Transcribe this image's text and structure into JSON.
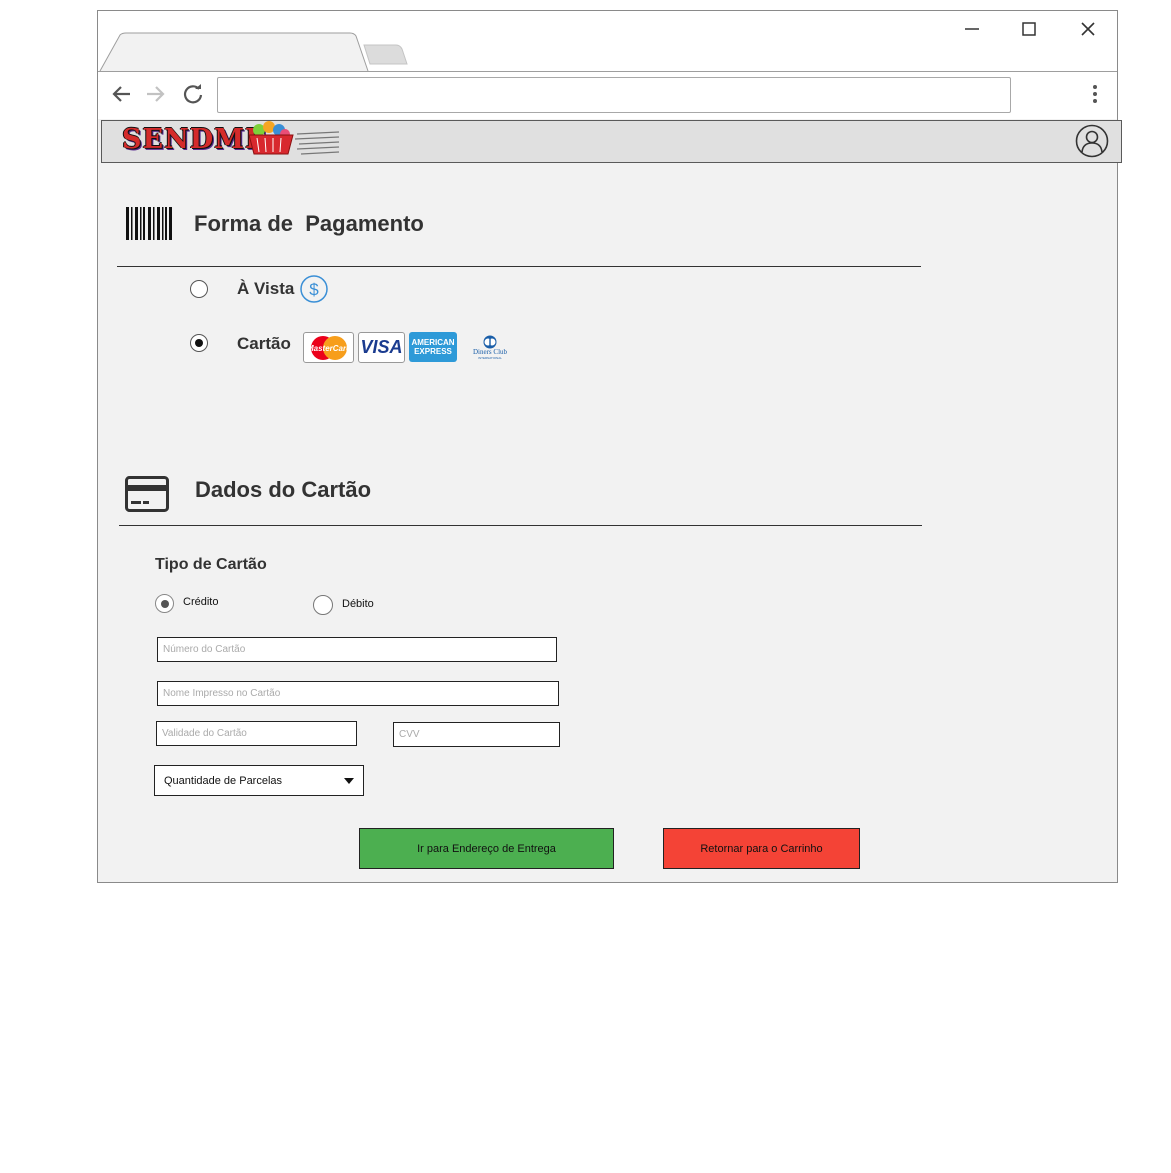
{
  "browser": {
    "address_value": "",
    "window_controls": [
      "minimize-icon",
      "maximize-icon",
      "close-icon"
    ]
  },
  "header": {
    "logo_text": "SENDME",
    "profile_icon": "user-circle-icon"
  },
  "payment": {
    "title": "Forma de  Pagamento",
    "title_icon": "barcode-icon",
    "options": [
      {
        "label": "À Vista",
        "selected": false,
        "icon": "dollar-circle-icon"
      },
      {
        "label": "Cartão",
        "selected": true
      }
    ],
    "card_brands": {
      "mastercard": "MasterCard",
      "visa": "VISA",
      "amex_line1": "AMERICAN",
      "amex_line2": "EXPRESS",
      "diners_line1": "Diners Club",
      "diners_line2": "INTERNATIONAL"
    }
  },
  "card_details": {
    "title": "Dados do Cartão",
    "title_icon": "credit-card-icon",
    "type_label": "Tipo de Cartão",
    "type_options": [
      {
        "label": "Crédito",
        "selected": true
      },
      {
        "label": "Débito",
        "selected": false
      }
    ],
    "fields": {
      "number_placeholder": "Número do Cartão",
      "name_placeholder": "Nome Impresso no Cartão",
      "expiry_placeholder": "Validade do Cartão",
      "cvv_placeholder": "CVV"
    },
    "installments_label": "Quantidade de Parcelas"
  },
  "actions": {
    "primary_label": "Ir para Endereço de Entrega",
    "secondary_label": "Retornar para o Carrinho"
  },
  "colors": {
    "primary_button": "#4caf50",
    "secondary_button": "#f44336",
    "accent_blue": "#3a8fd6",
    "page_bg": "#f2f2f2"
  }
}
